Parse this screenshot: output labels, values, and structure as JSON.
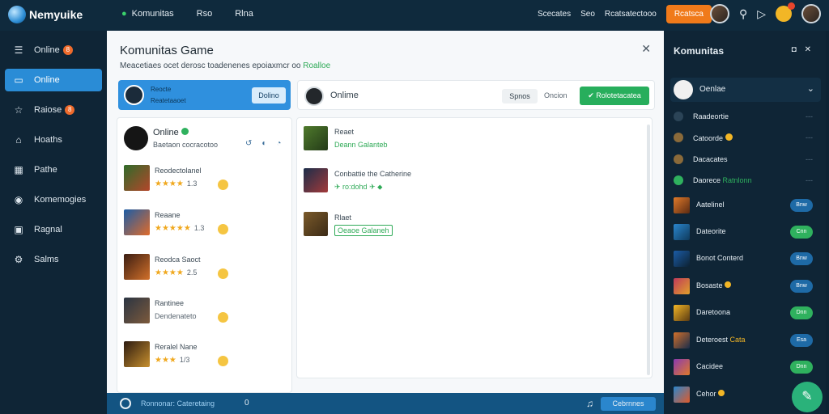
{
  "app": {
    "name": "Nemyuike"
  },
  "top_nav": [
    "Komunitas",
    "Rso",
    "Rlna"
  ],
  "top_right": {
    "link1": "Scecates",
    "link2": "Seo",
    "link3": "Rcatsatectooo",
    "cta": "Rcatsca"
  },
  "sidebar": {
    "items": [
      {
        "label": "Online",
        "badge": "8"
      },
      {
        "label": "Online"
      },
      {
        "label": "Raiose",
        "badge": "8"
      },
      {
        "label": "Hoaths"
      },
      {
        "label": "Pathe"
      },
      {
        "label": "Komemogies"
      },
      {
        "label": "Ragnal"
      },
      {
        "label": "Salms"
      }
    ]
  },
  "main": {
    "title": "Komunitas Game",
    "desc": "Meacetiaes ocet derosc toadenenes epoiaxmcr oo",
    "desc_highlight": "Roalloe",
    "card": {
      "line1": "Reocte",
      "line2": "Reatetaaoet",
      "button": "Dolino"
    },
    "bar": {
      "label": "Onlime",
      "option": "Spnos",
      "option2": "Oncion",
      "go": "Rolotetacatea"
    },
    "left_head": {
      "title": "Online",
      "sub": "Baetaon cocracotoo"
    },
    "left_games": [
      {
        "name": "Reodectolanel",
        "stars": "★★★★",
        "score": "1.3"
      },
      {
        "name": "Reaane",
        "stars": "★★★★★",
        "score": "1.3"
      },
      {
        "name": "Reodca Saoct",
        "stars": "★★★★",
        "score": "2.5"
      },
      {
        "name": "Rantinee",
        "stars": "Dendenateto",
        "score": ""
      },
      {
        "name": "Reralel Nane",
        "stars": "★★★",
        "score": "1/3"
      }
    ],
    "right_games": [
      {
        "name": "Reaet",
        "status": "Deann Galanteb"
      },
      {
        "name": "Conbattie the Catherine",
        "status": "✈ ro:dohd ✈ ⬥"
      },
      {
        "name": "Rlaet",
        "status": "Oeaoe Galaneh"
      }
    ]
  },
  "bottom": {
    "text": "Ronnonar: Cateretaing",
    "count": "0",
    "button": "Cebrnnes"
  },
  "right_panel": {
    "title": "Komunitas",
    "head": "Oenlae",
    "rows": [
      "Raadeortie",
      "Catoorde",
      "Dacacates",
      "Daorece"
    ],
    "row_extra": "Ratnlonn",
    "games": [
      {
        "name": "Aatelinel",
        "pill": "Bnw",
        "pill_color": "blue"
      },
      {
        "name": "Dateorite",
        "pill": "Cnn",
        "pill_color": "green"
      },
      {
        "name": "Bonot Conterd",
        "pill": "Bnw",
        "pill_color": "blue"
      },
      {
        "name": "Bosaste",
        "pill": "Bnw",
        "pill_color": "blue"
      },
      {
        "name": "Daretoona",
        "pill": "Dnn",
        "pill_color": "green"
      },
      {
        "name": "Deteroest",
        "pill": "Esa",
        "pill_color": "blue"
      },
      {
        "name": "Cacidee",
        "pill": "Dnn",
        "pill_color": "green"
      },
      {
        "name": "Cehor"
      }
    ],
    "highlight_suffix": "Cata"
  }
}
